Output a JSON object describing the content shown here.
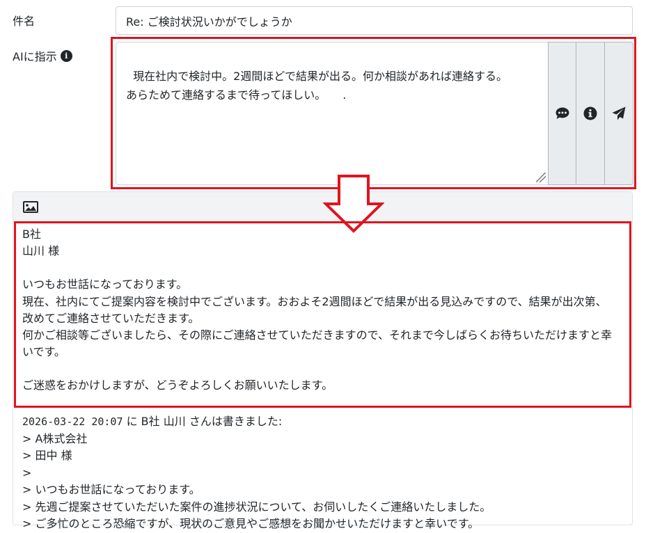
{
  "form": {
    "subject_label": "件名",
    "subject_value": "Re: ご検討状況いかがでしょうか",
    "ai_label": "AIに指示",
    "ai_text": "現在社内で検討中。2週間ほどで結果が出る。何か相談があれば連絡する。\nあらためて連絡するまで待ってほしい。　　."
  },
  "buttons": {
    "chat_icon": "comment-dots-icon",
    "info_icon": "info-circle-icon",
    "send_icon": "paper-plane-icon"
  },
  "reply": {
    "lines": [
      "B社",
      "山川 様",
      "",
      "いつもお世話になっております。",
      "現在、社内にてご提案内容を検討中でございます。おおよそ2週間ほどで結果が出る見込みですので、結果が出次第、",
      "改めてご連絡させていただきます。",
      "何かご相談等ございましたら、その際にご連絡させていただきますので、それまで今しばらくお待ちいただけますと幸",
      "いです。",
      "",
      "ご迷惑をおかけしますが、どうぞよろしくお願いいたします。"
    ]
  },
  "quote": {
    "header_datetime": "2026-03-22 20:07",
    "header_rest": " に B社 山川 さんは書きました:",
    "lines": [
      "> A株式会社",
      "> 田中 様",
      ">",
      "> いつもお世話になっております。",
      "> 先週ご提案させていただいた案件の進捗状況について、お伺いしたくご連絡いたしました。",
      "> ご多忙のところ恐縮ですが、現状のご意見やご感想をお聞かせいただけますと幸いです。"
    ]
  },
  "colors": {
    "highlight": "#e0141e"
  }
}
